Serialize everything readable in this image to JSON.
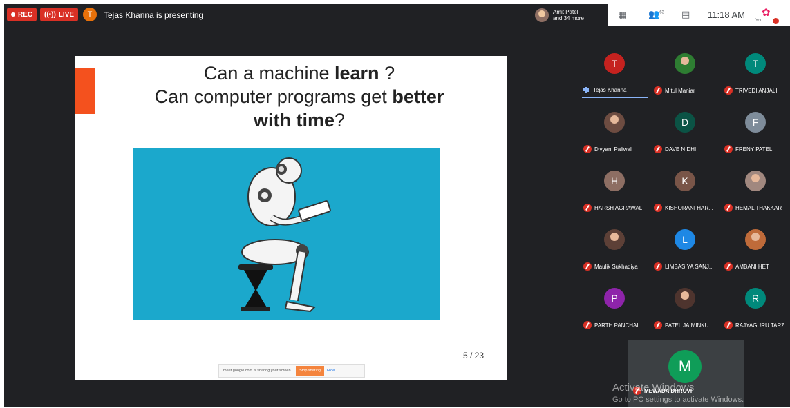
{
  "topbar": {
    "rec_label": "REC",
    "live_label": "LIVE",
    "presenter_initial": "T",
    "presenter_text": "Tejas Khanna is presenting",
    "participants_summary_line1": "Amit Patel",
    "participants_summary_line2": "and 34 more",
    "people_count": "63",
    "time": "11:18 AM",
    "you_label": "You",
    "accent_red": "#d93025"
  },
  "slide": {
    "title_line1_a": "Can a machine ",
    "title_line1_b": "learn",
    "title_line1_c": " ?",
    "title_line2_a": "Can computer programs get ",
    "title_line2_b": "better",
    "title_line3_a": "with time",
    "title_line3_b": "?",
    "page": "5 / 23",
    "share_text": "meet.google.com is sharing your screen.",
    "stop_sharing": "Stop sharing",
    "hide": "Hide"
  },
  "participants": [
    {
      "initial": "T",
      "name": "Tejas Khanna",
      "color": "#c5221f",
      "muted": false
    },
    {
      "initial": "",
      "name": "Mitul Maniar",
      "color": "#2e7d32",
      "muted": true,
      "photo": true
    },
    {
      "initial": "T",
      "name": "TRIVEDI ANJALI",
      "color": "#00897b",
      "muted": true
    },
    {
      "initial": "",
      "name": "Divyani Paliwal",
      "color": "#6d4c41",
      "muted": true,
      "photo": true
    },
    {
      "initial": "D",
      "name": "DAVE NIDHI",
      "color": "#0b5345",
      "muted": true
    },
    {
      "initial": "F",
      "name": "FRENY PATEL",
      "color": "#7e8c9a",
      "muted": true
    },
    {
      "initial": "H",
      "name": "HARSH AGRAWAL",
      "color": "#8d6e63",
      "muted": true
    },
    {
      "initial": "K",
      "name": "KISHORANI HAR...",
      "color": "#795548",
      "muted": true
    },
    {
      "initial": "",
      "name": "HEMAL THAKKAR",
      "color": "#a1887f",
      "muted": true,
      "photo": true
    },
    {
      "initial": "",
      "name": "Maulik Sukhadiya",
      "color": "#5d4037",
      "muted": true,
      "photo": true
    },
    {
      "initial": "L",
      "name": "LIMBASIYA SANJ...",
      "color": "#1e88e5",
      "muted": true
    },
    {
      "initial": "",
      "name": "AMBANI HET",
      "color": "#bf6b3a",
      "muted": true,
      "photo": true
    },
    {
      "initial": "P",
      "name": "PARTH PANCHAL",
      "color": "#8e24aa",
      "muted": true
    },
    {
      "initial": "",
      "name": "PATEL JAIMINKU...",
      "color": "#4e342e",
      "muted": true,
      "photo": true
    },
    {
      "initial": "R",
      "name": "RAJYAGURU TARZ",
      "color": "#00897b",
      "muted": true
    }
  ],
  "bottom_tile": {
    "initial": "M",
    "name": "MEWADA DHRUVI"
  },
  "watermark": {
    "line1": "Activate Windows",
    "line2": "Go to PC settings to activate Windows."
  }
}
